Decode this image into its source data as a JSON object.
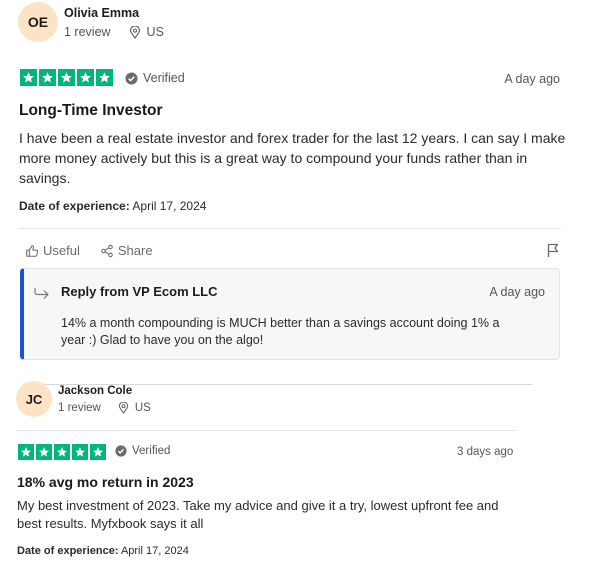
{
  "reviews": [
    {
      "initials": "OE",
      "name": "Olivia Emma",
      "review_count": "1 review",
      "country": "US",
      "verified_label": "Verified",
      "date_ago": "A day ago",
      "title": "Long-Time Investor",
      "body": "I have been a real estate investor and forex trader for the last 12 years. I can say I make more money actively but this is a great way to compound your funds rather than in savings.",
      "experience_label": "Date of experience:",
      "experience_date": "April 17, 2024",
      "rating": 5,
      "useful_label": "Useful",
      "share_label": "Share",
      "reply": {
        "from": "Reply from VP Ecom LLC",
        "date_ago": "A day ago",
        "text": "14% a month compounding is MUCH better than a savings account doing 1% a year :) Glad to have you on the algo!"
      }
    },
    {
      "initials": "JC",
      "name": "Jackson Cole",
      "review_count": "1 review",
      "country": "US",
      "verified_label": "Verified",
      "date_ago": "3 days ago",
      "title": "18% avg mo return in 2023",
      "body": "My best investment of 2023. Take my advice and give it a try, lowest upfront fee and best results. Myfxbook says it all",
      "experience_label": "Date of experience:",
      "experience_date": "April 17, 2024",
      "rating": 5
    }
  ],
  "colors": {
    "star_green": "#00b67a",
    "reply_accent": "#1a55d0",
    "avatar_bg": "#fde3c6"
  },
  "icons": [
    "location-pin-icon",
    "verified-check-icon",
    "thumbs-up-icon",
    "share-icon",
    "flag-icon",
    "reply-arrow-icon"
  ]
}
